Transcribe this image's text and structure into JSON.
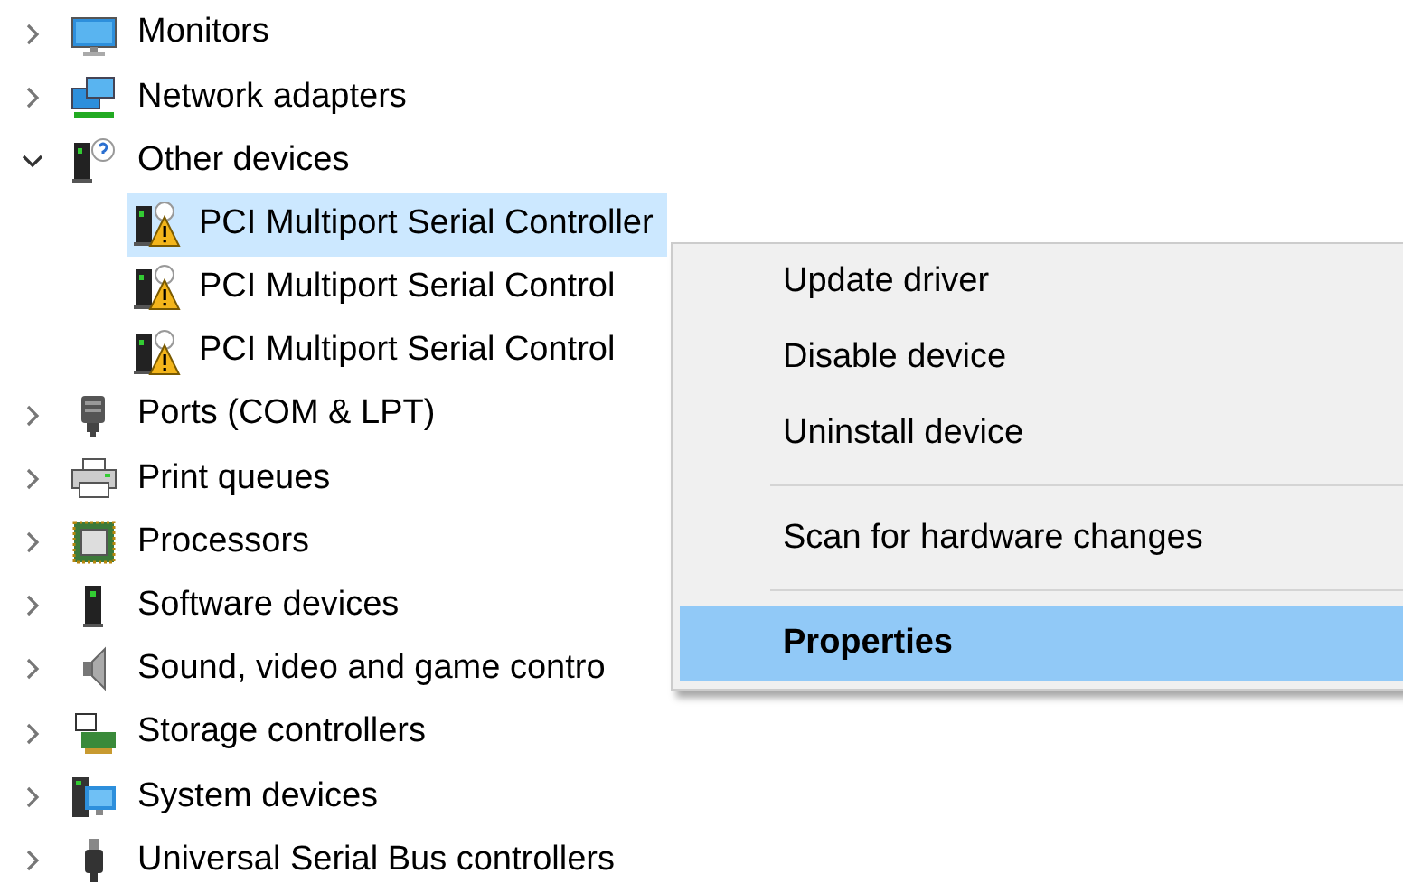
{
  "tree": [
    {
      "label": "Monitors",
      "expanded": false,
      "selected": false
    },
    {
      "label": "Network adapters",
      "expanded": false,
      "selected": false
    },
    {
      "label": "Other devices",
      "expanded": true,
      "selected": false,
      "children": [
        {
          "label": "PCI Multiport Serial Controller",
          "selected": true
        },
        {
          "label": "PCI Multiport Serial Control",
          "selected": false
        },
        {
          "label": "PCI Multiport Serial Control",
          "selected": false
        }
      ]
    },
    {
      "label": "Ports (COM & LPT)",
      "expanded": false,
      "selected": false
    },
    {
      "label": "Print queues",
      "expanded": false,
      "selected": false
    },
    {
      "label": "Processors",
      "expanded": false,
      "selected": false
    },
    {
      "label": "Software devices",
      "expanded": false,
      "selected": false
    },
    {
      "label": "Sound, video and game contro",
      "expanded": false,
      "selected": false
    },
    {
      "label": "Storage controllers",
      "expanded": false,
      "selected": false
    },
    {
      "label": "System devices",
      "expanded": false,
      "selected": false
    },
    {
      "label": "Universal Serial Bus controllers",
      "expanded": false,
      "selected": false
    }
  ],
  "context_menu": [
    {
      "kind": "item",
      "label": "Update driver",
      "selected": false,
      "default": false
    },
    {
      "kind": "item",
      "label": "Disable device",
      "selected": false,
      "default": false
    },
    {
      "kind": "item",
      "label": "Uninstall device",
      "selected": false,
      "default": false
    },
    {
      "kind": "separator"
    },
    {
      "kind": "item",
      "label": "Scan for hardware changes",
      "selected": false,
      "default": false
    },
    {
      "kind": "separator"
    },
    {
      "kind": "item",
      "label": "Properties",
      "selected": true,
      "default": true
    }
  ]
}
